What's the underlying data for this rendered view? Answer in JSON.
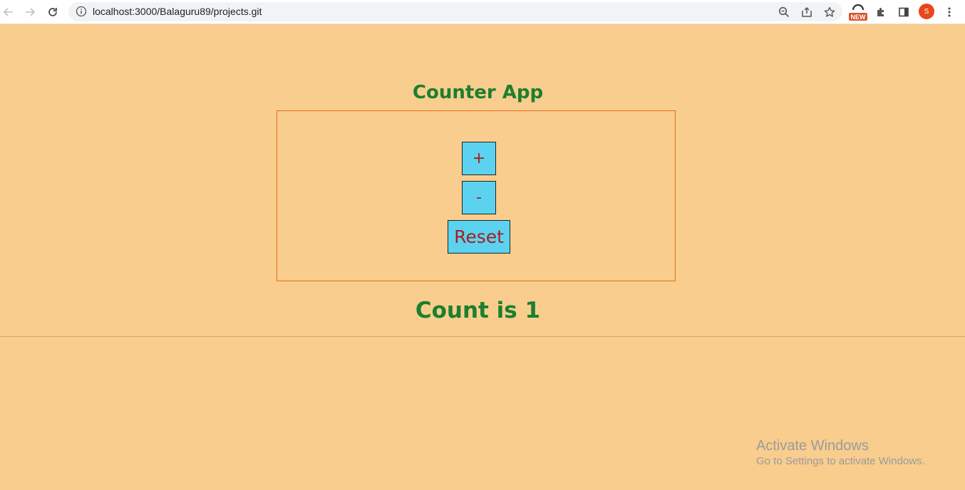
{
  "browser": {
    "url": "localhost:3000/Balaguru89/projects.git",
    "new_badge": "NEW",
    "profile_initial": "S"
  },
  "app": {
    "title": "Counter App",
    "buttons": {
      "increment": "+",
      "decrement": "-",
      "reset": "Reset"
    },
    "count_text": "Count is 1"
  },
  "watermark": {
    "title": "Activate Windows",
    "subtitle": "Go to Settings to activate Windows."
  },
  "colors": {
    "background": "#f8cd8d",
    "heading": "#1b7f2f",
    "button_fill": "#5bd3f0",
    "button_text": "#a51f1f",
    "panel_border": "#e86a1a"
  }
}
